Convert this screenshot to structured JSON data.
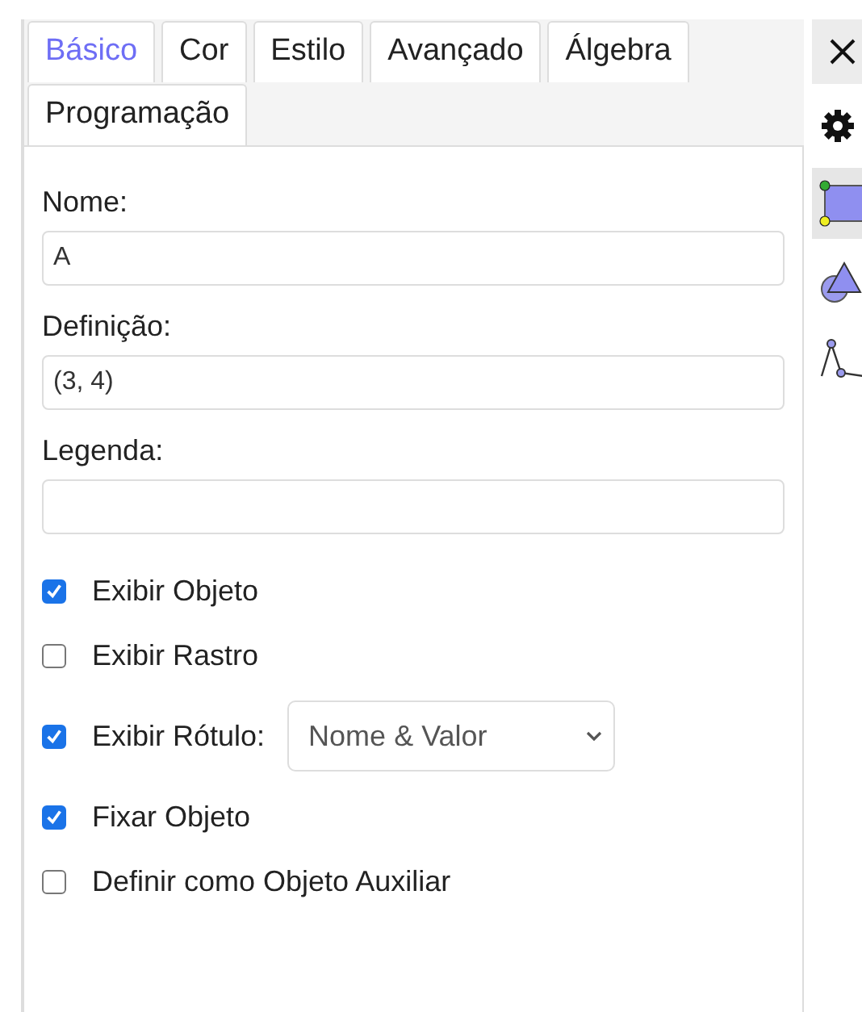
{
  "tabs": [
    {
      "label": "Básico",
      "selected": true
    },
    {
      "label": "Cor",
      "selected": false
    },
    {
      "label": "Estilo",
      "selected": false
    },
    {
      "label": "Avançado",
      "selected": false
    },
    {
      "label": "Álgebra",
      "selected": false
    },
    {
      "label": "Programação",
      "selected": false
    }
  ],
  "fields": [
    {
      "label": "Nome:",
      "value": "A"
    },
    {
      "label": "Definição:",
      "value": "(3, 4)"
    },
    {
      "label": "Legenda:"
    }
  ],
  "options": [
    {
      "kind": "checkbox",
      "label": "Exibir Objeto",
      "checked": true
    },
    {
      "kind": "checkbox",
      "label": "Exibir Rastro",
      "checked": false
    },
    {
      "kind": "checkbox-select",
      "label": "Exibir Rótulo:",
      "checked": true,
      "select": "Nome & Valor"
    },
    {
      "kind": "checkbox",
      "label": "Fixar Objeto",
      "checked": true
    },
    {
      "kind": "checkbox",
      "label": "Definir como Objeto Auxiliar",
      "checked": false
    }
  ],
  "toolbar": [
    {
      "kind": "settings",
      "selected": false
    },
    {
      "kind": "rect",
      "selected": true
    },
    {
      "kind": "shapes",
      "selected": false
    },
    {
      "kind": "polyline",
      "selected": false
    }
  ]
}
